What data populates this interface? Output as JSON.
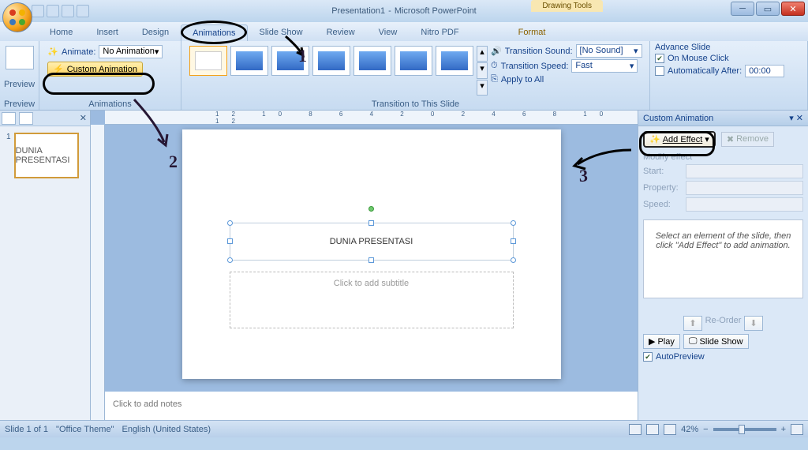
{
  "title": {
    "doc": "Presentation1",
    "app": "Microsoft PowerPoint",
    "context": "Drawing Tools"
  },
  "tabs": [
    "Home",
    "Insert",
    "Design",
    "Animations",
    "Slide Show",
    "Review",
    "View",
    "Nitro PDF"
  ],
  "active_tab": "Animations",
  "format_tab": "Format",
  "ribbon": {
    "preview": {
      "label": "Preview",
      "btn": "Preview"
    },
    "animations": {
      "label": "Animations",
      "animate": "Animate:",
      "animate_val": "No Animation",
      "custom": "Custom Animation"
    },
    "transition": {
      "label": "Transition to This Slide",
      "sound_lbl": "Transition Sound:",
      "sound_val": "[No Sound]",
      "speed_lbl": "Transition Speed:",
      "speed_val": "Fast",
      "apply": "Apply to All"
    },
    "advance": {
      "heading": "Advance Slide",
      "onclick": "On Mouse Click",
      "auto": "Automatically After:",
      "auto_val": "00:00"
    }
  },
  "slide": {
    "title": "DUNIA PRESENTASI",
    "subtitle": "Click to add subtitle",
    "thumb": "DUNIA PRESENTASI"
  },
  "notes": "Click to add notes",
  "taskpane": {
    "title": "Custom Animation",
    "add": "Add Effect",
    "remove": "Remove",
    "modify": "Modify effect",
    "start": "Start:",
    "property": "Property:",
    "speed": "Speed:",
    "hint": "Select an element of the slide, then click \"Add Effect\" to add animation.",
    "reorder": "Re-Order",
    "play": "Play",
    "show": "Slide Show",
    "auto": "AutoPreview"
  },
  "status": {
    "slide": "Slide 1 of 1",
    "theme": "\"Office Theme\"",
    "lang": "English (United States)",
    "zoom": "42%"
  },
  "annotations": {
    "n1": "1",
    "n2": "2",
    "n3": "3"
  }
}
